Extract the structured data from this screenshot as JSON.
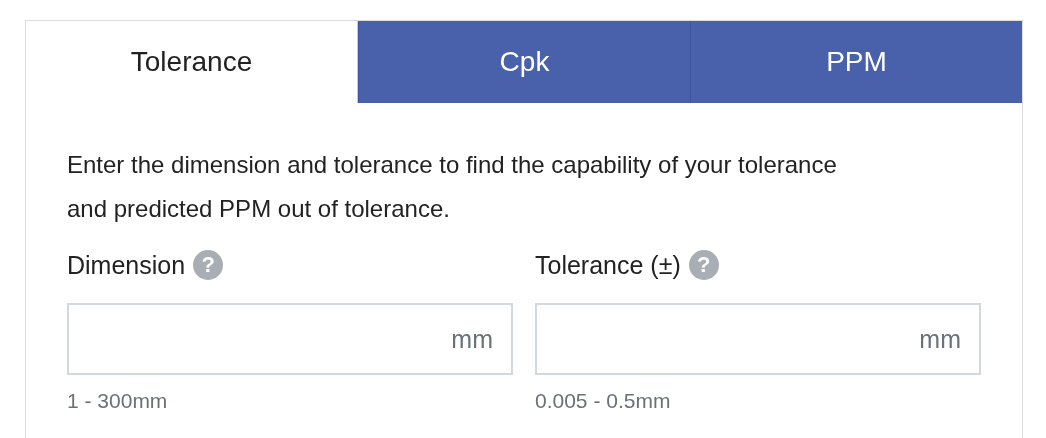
{
  "tabs": [
    {
      "label": "Tolerance",
      "selected": true
    },
    {
      "label": "Cpk",
      "selected": false
    },
    {
      "label": "PPM",
      "selected": false
    }
  ],
  "intro": "Enter the dimension and tolerance to find the capability of your tolerance and predicted PPM out of tolerance.",
  "fields": [
    {
      "label": "Dimension",
      "help": "?",
      "unit": "mm",
      "hint": "1 - 300mm"
    },
    {
      "label": "Tolerance (±)",
      "help": "?",
      "unit": "mm",
      "hint": "0.005 - 0.5mm"
    }
  ]
}
